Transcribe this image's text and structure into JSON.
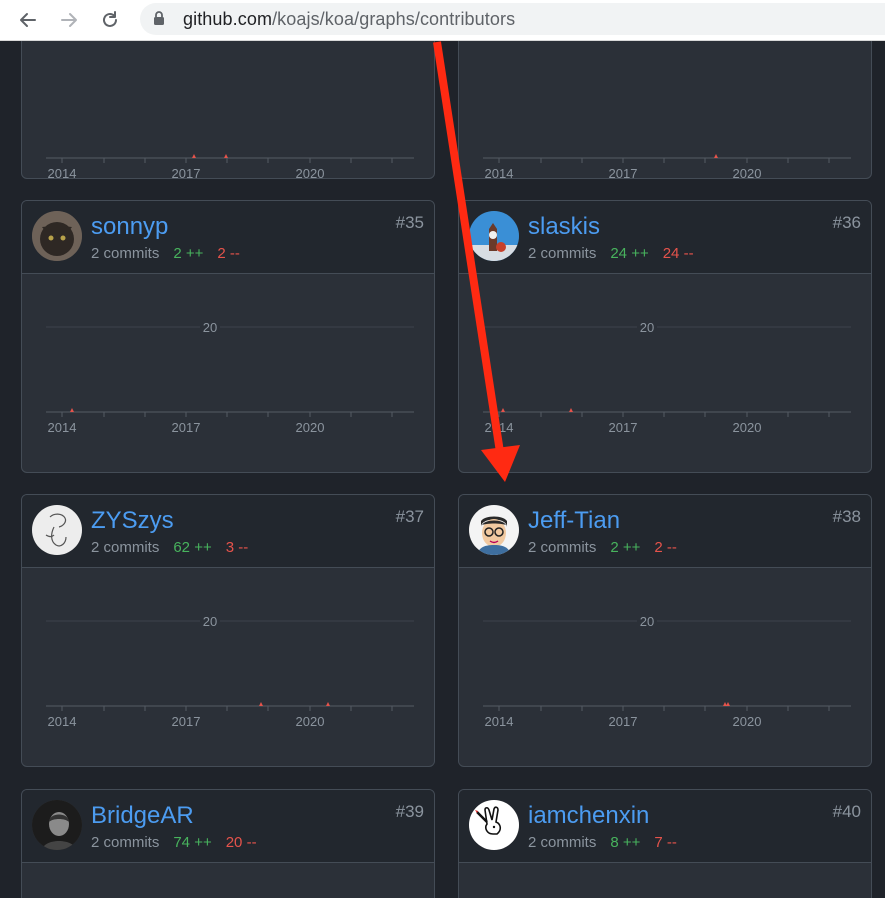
{
  "browser": {
    "url_host": "github.com",
    "url_path": "/koajs/koa/graphs/contributors"
  },
  "axis": {
    "ticks": [
      "2014",
      "2017",
      "2020"
    ],
    "gridline_label": "20"
  },
  "contributors": [
    {
      "name": "sonnyp",
      "commits": "2 commits",
      "additions": "2 ++",
      "deletions": "2 --",
      "rank": "#35"
    },
    {
      "name": "slaskis",
      "commits": "2 commits",
      "additions": "24 ++",
      "deletions": "24 --",
      "rank": "#36"
    },
    {
      "name": "ZYSzys",
      "commits": "2 commits",
      "additions": "62 ++",
      "deletions": "3 --",
      "rank": "#37"
    },
    {
      "name": "Jeff-Tian",
      "commits": "2 commits",
      "additions": "2 ++",
      "deletions": "2 --",
      "rank": "#38"
    },
    {
      "name": "BridgeAR",
      "commits": "2 commits",
      "additions": "74 ++",
      "deletions": "20 --",
      "rank": "#39"
    },
    {
      "name": "iamchenxin",
      "commits": "2 commits",
      "additions": "8 ++",
      "deletions": "7 --",
      "rank": "#40"
    }
  ],
  "colors": {
    "link": "#4c9cf1",
    "additions": "#48b35d",
    "deletions": "#e5534b",
    "annotation_arrow": "#ff2a12"
  }
}
